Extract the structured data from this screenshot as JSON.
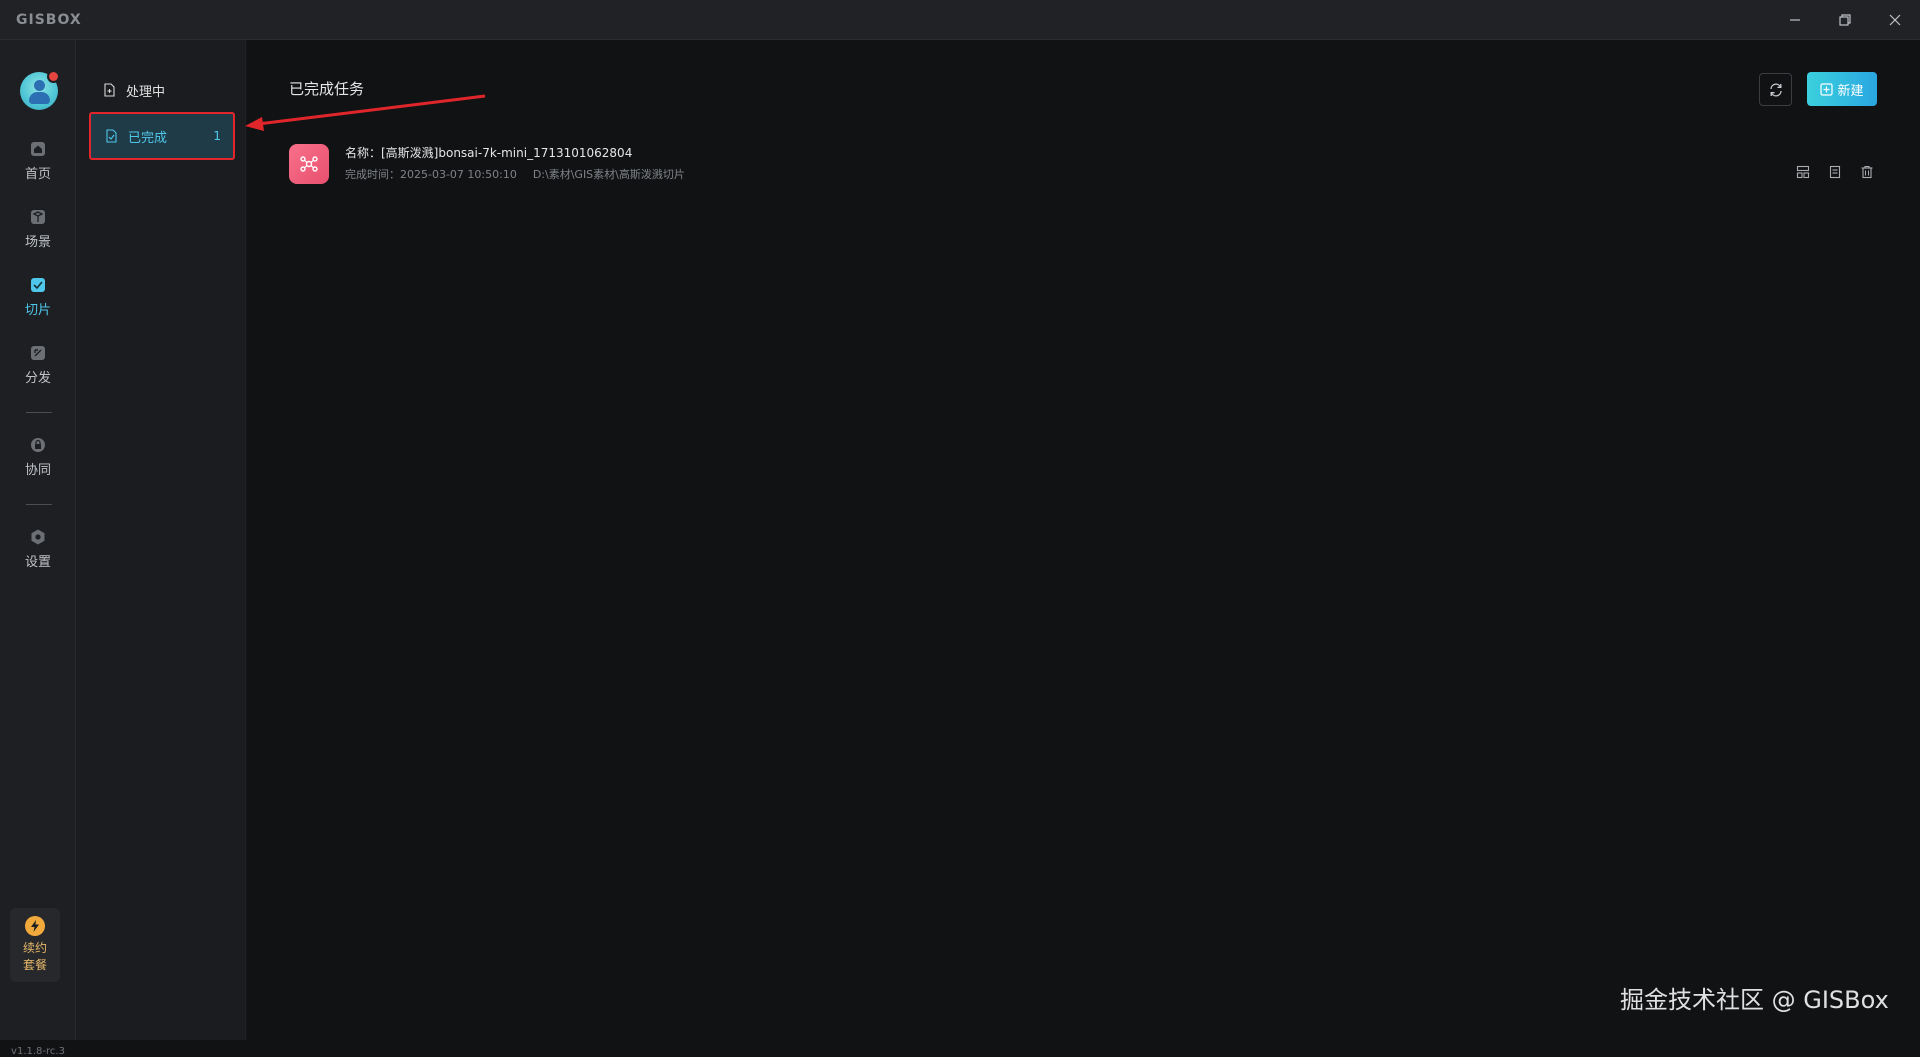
{
  "app": {
    "logo": "GISBOX"
  },
  "nav": {
    "items": [
      {
        "label": "首页",
        "icon": "home-icon"
      },
      {
        "label": "场景",
        "icon": "scene-icon"
      },
      {
        "label": "切片",
        "icon": "slice-icon"
      },
      {
        "label": "分发",
        "icon": "distribute-icon"
      },
      {
        "label": "协同",
        "icon": "collab-icon"
      },
      {
        "label": "设置",
        "icon": "settings-icon"
      }
    ],
    "plan_card": {
      "line1": "续约",
      "line2": "套餐"
    },
    "version": "v1.1.8-rc.3"
  },
  "subnav": {
    "processing": {
      "label": "处理中"
    },
    "completed": {
      "label": "已完成",
      "count": "1"
    }
  },
  "main": {
    "title": "已完成任务",
    "new_button": "新建",
    "task": {
      "name": "名称：[高斯泼溅]bonsai-7k-mini_1713101062804",
      "completed_time": "完成时间：2025-03-07 10:50:10",
      "path": "D:\\素材\\GIS素材\\高斯泼溅切片"
    }
  },
  "watermark": "掘金技术社区 @ GISBox",
  "colors": {
    "accent": "#4fc7ea",
    "highlight_border": "#e0262b",
    "task_icon": "#f8708a"
  }
}
